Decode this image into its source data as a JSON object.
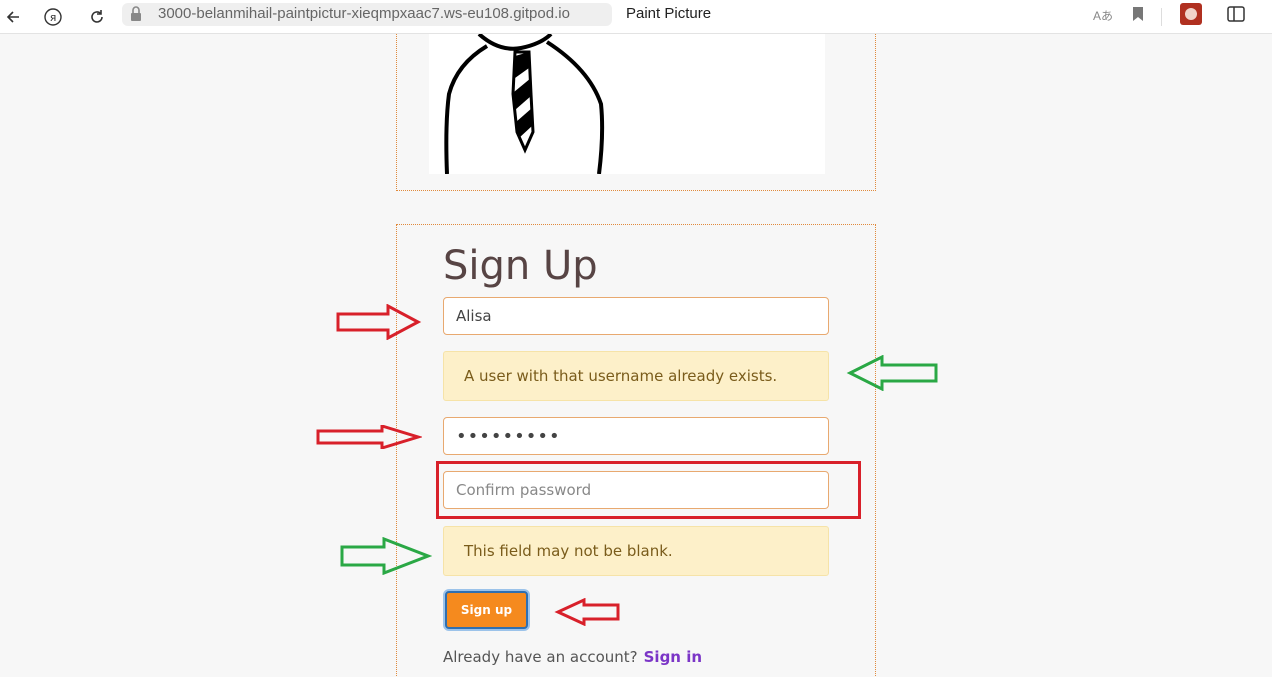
{
  "browser": {
    "url": "3000-belanmihail-paintpictur-xieqmpxaac7.ws-eu108.gitpod.io",
    "tab_title": "Paint Picture",
    "translate_label": "Aあ"
  },
  "signup": {
    "title": "Sign Up",
    "username_value": "Alisa",
    "username_error": "A user with that username already exists.",
    "password_value": "•••••••••",
    "confirm_placeholder": "Confirm password",
    "confirm_error": "This field may not be blank.",
    "submit_label": "Sign up",
    "account_prompt": "Already have an account?",
    "signin_label": "Sign in"
  },
  "colors": {
    "accent": "#f58a1e",
    "panel_border": "#e08a3c",
    "red_arrow": "#d8202a",
    "green_arrow": "#2aa845",
    "alert_bg": "#fdf0c9",
    "link": "#7b35c7"
  },
  "icons": [
    "back-icon",
    "yandex-icon",
    "reload-icon",
    "lock-icon",
    "translate-icon",
    "bookmark-icon",
    "extension-icon",
    "sidebar-icon"
  ]
}
